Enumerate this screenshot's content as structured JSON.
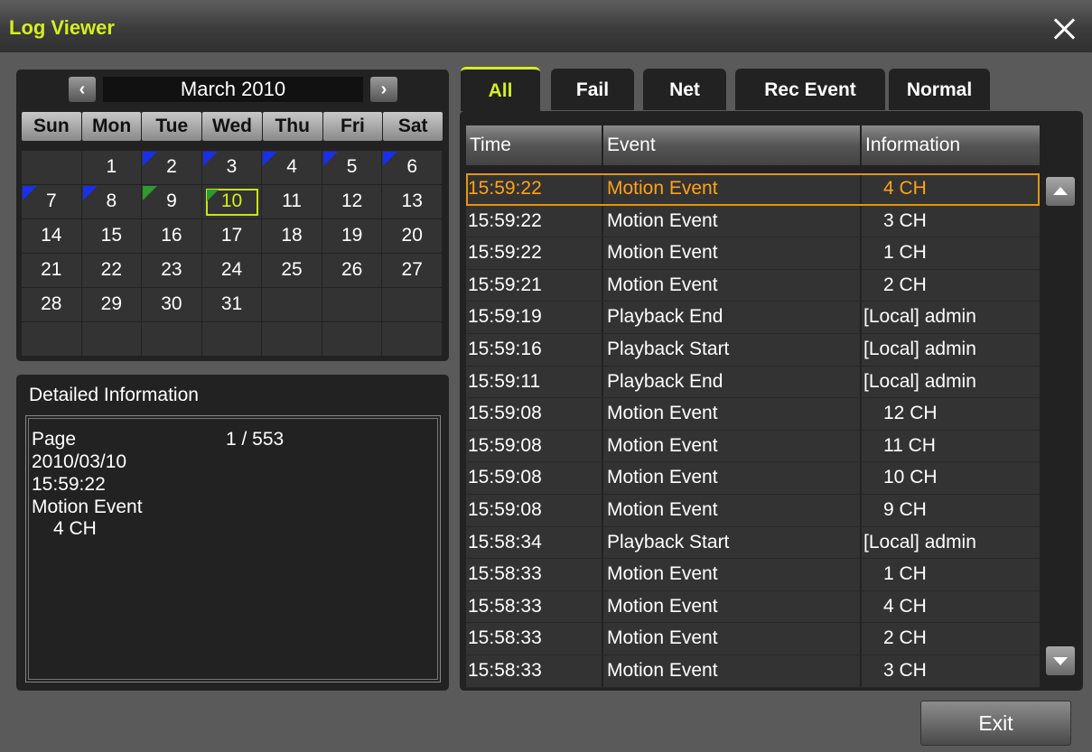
{
  "window": {
    "title": "Log Viewer"
  },
  "calendar": {
    "month_label": "March 2010",
    "prev_icon": "chevron-left-icon",
    "next_icon": "chevron-right-icon",
    "day_names": [
      "Sun",
      "Mon",
      "Tue",
      "Wed",
      "Thu",
      "Fri",
      "Sat"
    ],
    "weeks": [
      [
        {
          "d": ""
        },
        {
          "d": "1"
        },
        {
          "d": "2",
          "mark": "blue"
        },
        {
          "d": "3",
          "mark": "blue"
        },
        {
          "d": "4",
          "mark": "blue"
        },
        {
          "d": "5",
          "mark": "blue"
        },
        {
          "d": "6",
          "mark": "blue"
        }
      ],
      [
        {
          "d": "7",
          "mark": "blue"
        },
        {
          "d": "8",
          "mark": "blue"
        },
        {
          "d": "9",
          "mark": "green"
        },
        {
          "d": "10",
          "mark": "green",
          "today": true
        },
        {
          "d": "11"
        },
        {
          "d": "12"
        },
        {
          "d": "13"
        }
      ],
      [
        {
          "d": "14"
        },
        {
          "d": "15"
        },
        {
          "d": "16"
        },
        {
          "d": "17"
        },
        {
          "d": "18"
        },
        {
          "d": "19"
        },
        {
          "d": "20"
        }
      ],
      [
        {
          "d": "21"
        },
        {
          "d": "22"
        },
        {
          "d": "23"
        },
        {
          "d": "24"
        },
        {
          "d": "25"
        },
        {
          "d": "26"
        },
        {
          "d": "27"
        }
      ],
      [
        {
          "d": "28"
        },
        {
          "d": "29"
        },
        {
          "d": "30"
        },
        {
          "d": "31"
        },
        {
          "d": ""
        },
        {
          "d": ""
        },
        {
          "d": ""
        }
      ],
      [
        {
          "d": ""
        },
        {
          "d": ""
        },
        {
          "d": ""
        },
        {
          "d": ""
        },
        {
          "d": ""
        },
        {
          "d": ""
        },
        {
          "d": ""
        }
      ]
    ],
    "mark_colors": {
      "blue": "#1a2fe8",
      "green": "#2f9a2f"
    }
  },
  "detail": {
    "title": "Detailed Information",
    "page_label": "Page",
    "page_value": "1 / 553",
    "date": "2010/03/10",
    "time": "15:59:22",
    "event": "Motion Event",
    "info": "4 CH"
  },
  "tabs": [
    {
      "label": "All",
      "active": true
    },
    {
      "label": "Fail"
    },
    {
      "label": "Net"
    },
    {
      "label": "Rec Event"
    },
    {
      "label": "Normal"
    }
  ],
  "log": {
    "headers": [
      "Time",
      "Event",
      "Information"
    ],
    "rows": [
      [
        "15:59:22",
        "Motion Event",
        "4 CH"
      ],
      [
        "15:59:22",
        "Motion Event",
        "3 CH"
      ],
      [
        "15:59:22",
        "Motion Event",
        "1 CH"
      ],
      [
        "15:59:21",
        "Motion Event",
        "2 CH"
      ],
      [
        "15:59:19",
        "Playback End",
        "[Local] admin"
      ],
      [
        "15:59:16",
        "Playback Start",
        "[Local] admin"
      ],
      [
        "15:59:11",
        "Playback End",
        "[Local] admin"
      ],
      [
        "15:59:08",
        "Motion Event",
        "12 CH"
      ],
      [
        "15:59:08",
        "Motion Event",
        "11 CH"
      ],
      [
        "15:59:08",
        "Motion Event",
        "10 CH"
      ],
      [
        "15:59:08",
        "Motion Event",
        "9 CH"
      ],
      [
        "15:58:34",
        "Playback Start",
        "[Local] admin"
      ],
      [
        "15:58:33",
        "Motion Event",
        "1 CH"
      ],
      [
        "15:58:33",
        "Motion Event",
        "4 CH"
      ],
      [
        "15:58:33",
        "Motion Event",
        "2 CH"
      ],
      [
        "15:58:33",
        "Motion Event",
        "3 CH"
      ]
    ],
    "selected_index": 0,
    "scroll_up_icon": "scroll-up-arrow-icon",
    "scroll_down_icon": "scroll-down-arrow-icon"
  },
  "footer": {
    "exit_label": "Exit"
  },
  "colors": {
    "accent": "#d4ef1f",
    "selected": "#ffa21a"
  }
}
